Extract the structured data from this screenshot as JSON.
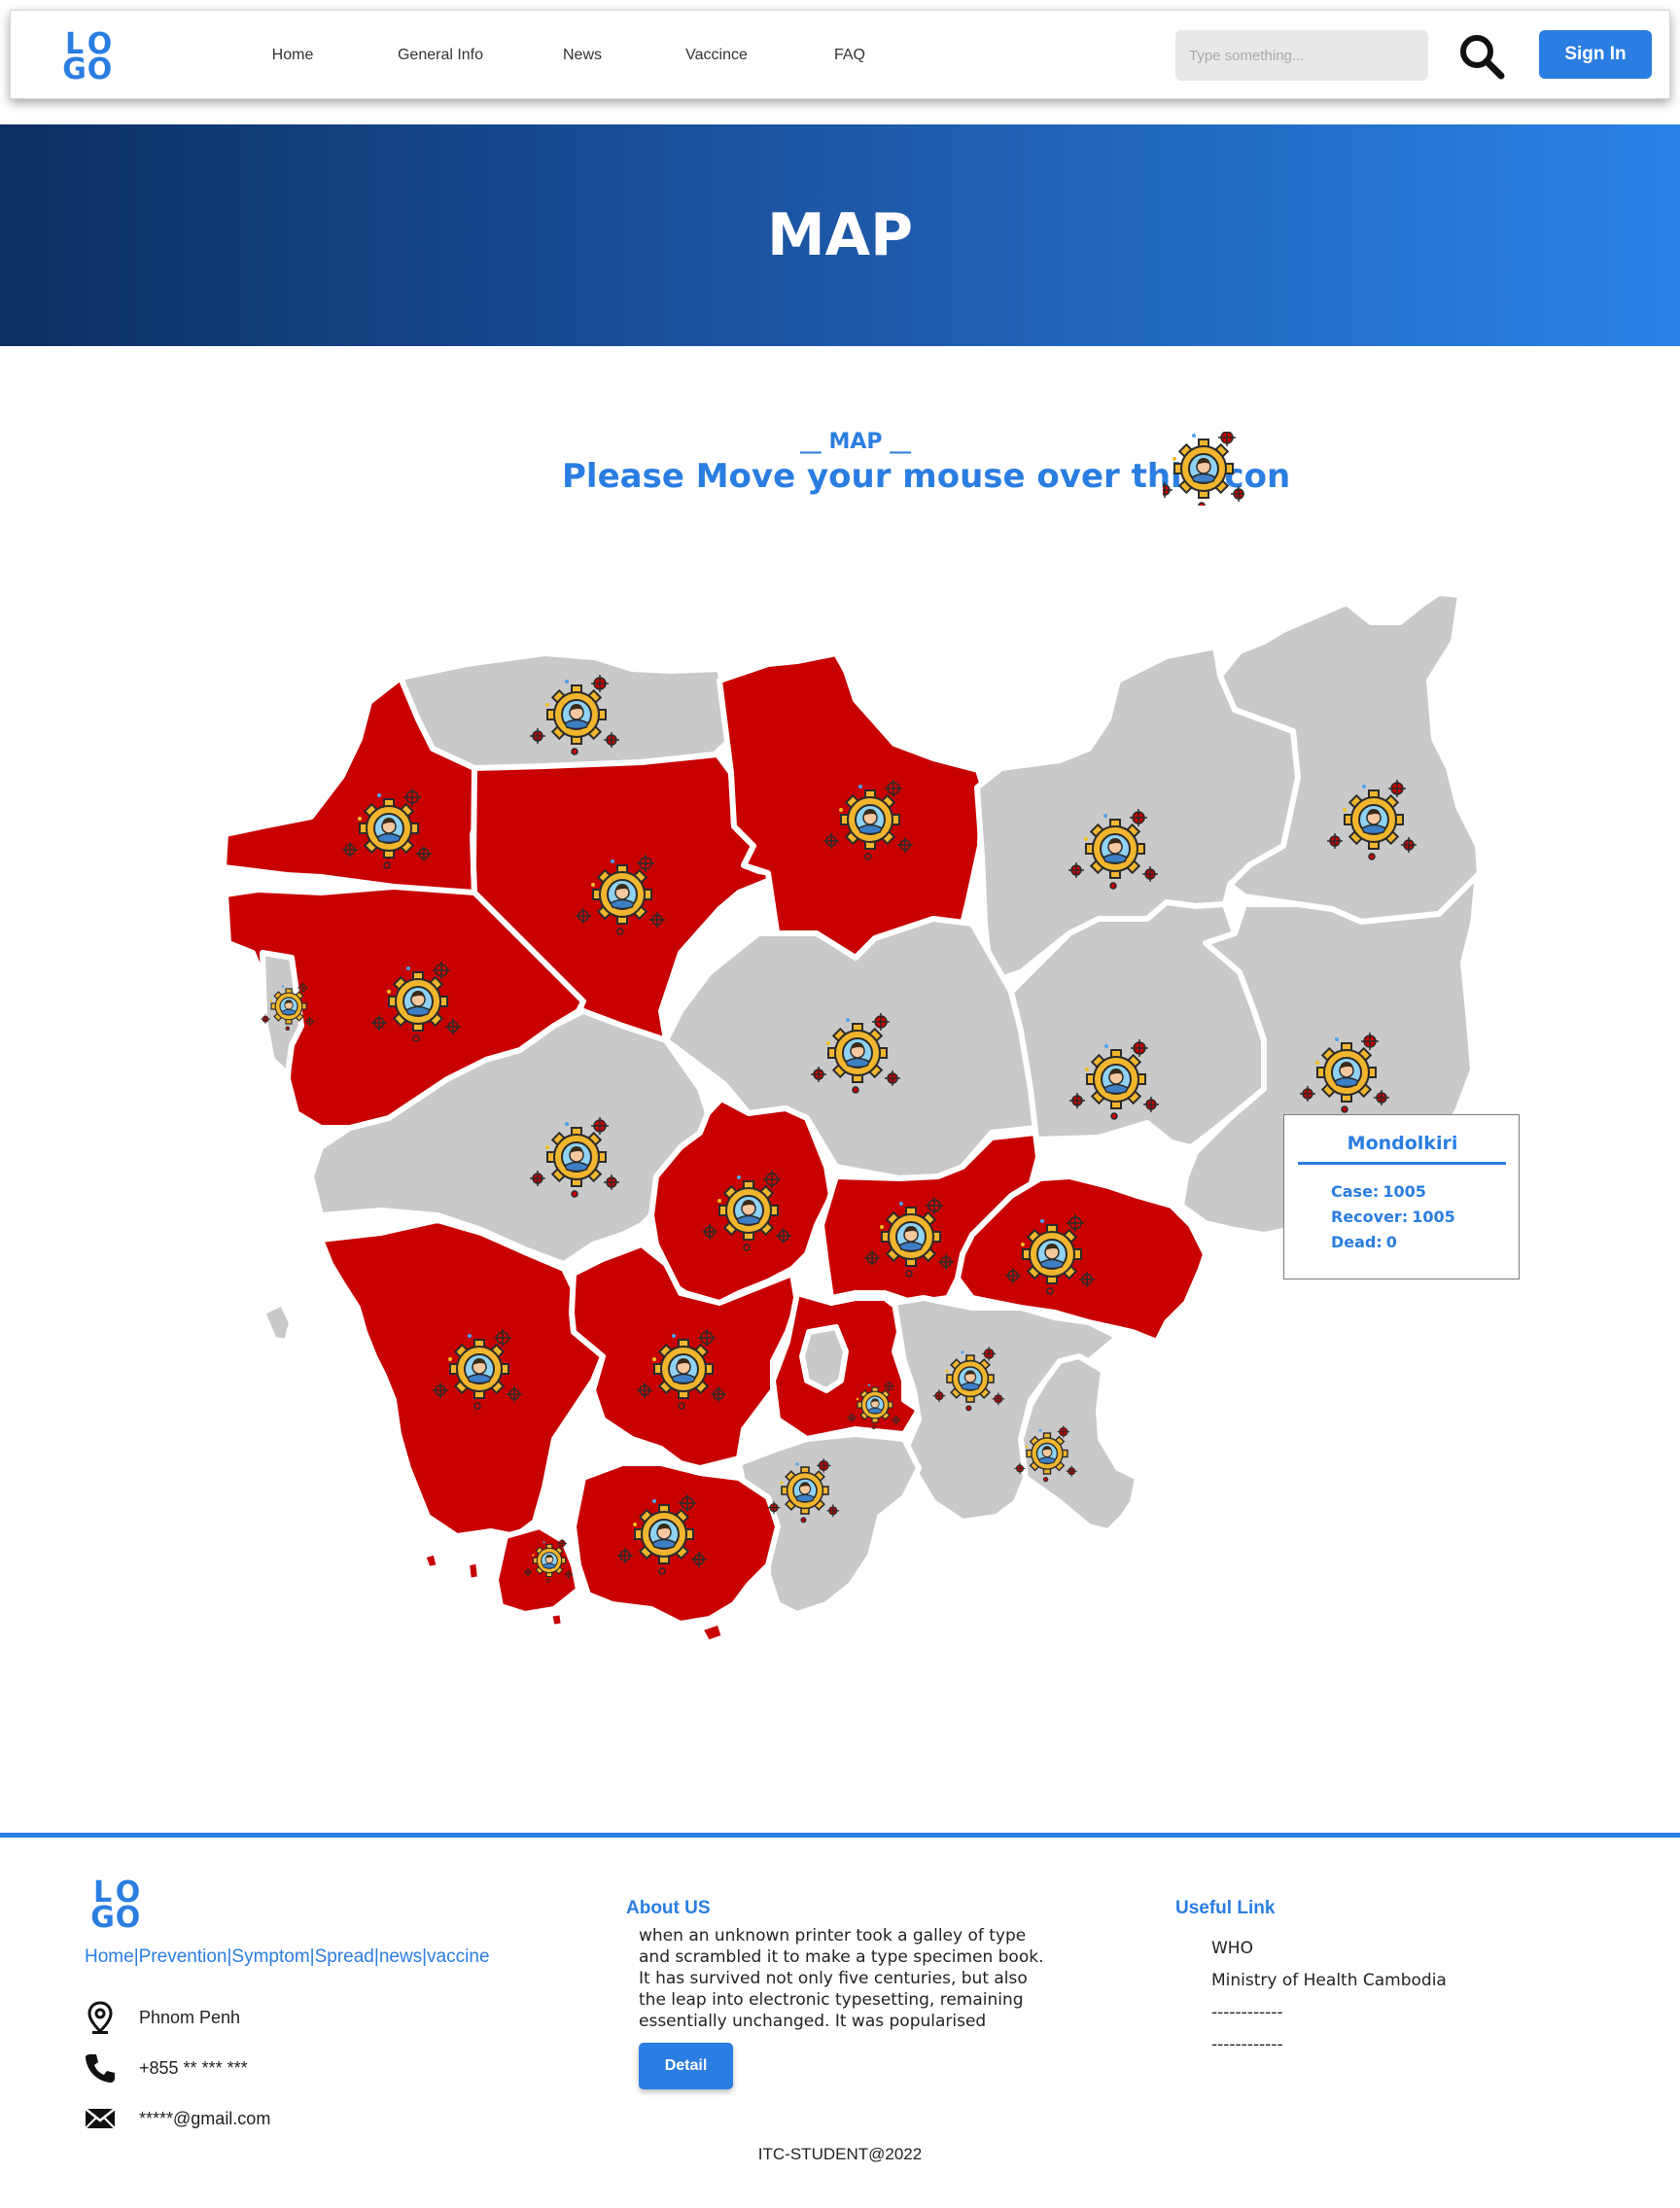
{
  "brand": {
    "logo_letters": [
      "L",
      "O",
      "G",
      "O"
    ]
  },
  "nav": {
    "links": [
      {
        "label": "Home"
      },
      {
        "label": "General Info"
      },
      {
        "label": "News"
      },
      {
        "label": "Vaccince"
      },
      {
        "label": "FAQ"
      }
    ],
    "search_placeholder": "Type something...",
    "sign_in_label": "Sign In"
  },
  "hero": {
    "title": "MAP"
  },
  "section": {
    "kicker": "__ MAP __",
    "subtitle": "Please Move your mouse over this icon",
    "hint_icon": "virus-gear-person-icon"
  },
  "map": {
    "marker_icon": "virus-gear-person-icon",
    "province_status_colors": {
      "infected": "#c80000",
      "not_infected": "#c9c9c9"
    }
  },
  "tooltip": {
    "province": "Mondolkiri",
    "stats": [
      {
        "label": "Case:",
        "value": "1005"
      },
      {
        "label": "Recover:",
        "value": "1005"
      },
      {
        "label": "Dead:",
        "value": "0"
      }
    ]
  },
  "footer": {
    "quick_links": [
      {
        "label": "Home"
      },
      {
        "label": "Prevention"
      },
      {
        "label": "Symptom"
      },
      {
        "label": "Spread"
      },
      {
        "label": "news"
      },
      {
        "label": "vaccine"
      }
    ],
    "quick_link_separator": "|",
    "contacts": [
      {
        "icon": "location-pin-icon",
        "text": "Phnom Penh"
      },
      {
        "icon": "phone-icon",
        "text": "+855 ** *** ***"
      },
      {
        "icon": "mail-icon",
        "text": "*****@gmail.com"
      }
    ],
    "about": {
      "title": "About US",
      "text": "when an unknown printer took a galley of type and scrambled it to make a type specimen book. It has survived not only five centuries, but also the leap into electronic typesetting, remaining essentially unchanged. It was popularised",
      "button_label": "Detail"
    },
    "useful_links": {
      "title": "Useful Link",
      "items": [
        {
          "label": "WHO"
        },
        {
          "label": "Ministry of Health Cambodia"
        },
        {
          "label": "------------"
        },
        {
          "label": "------------"
        }
      ]
    },
    "copyright": "ITC-STUDENT@2022"
  },
  "colors": {
    "accent": "#2a7de1",
    "hero_gradient_start": "#0c2f61",
    "hero_gradient_end": "#2b82e6",
    "infected": "#c80000",
    "not_infected": "#c9c9c9"
  }
}
